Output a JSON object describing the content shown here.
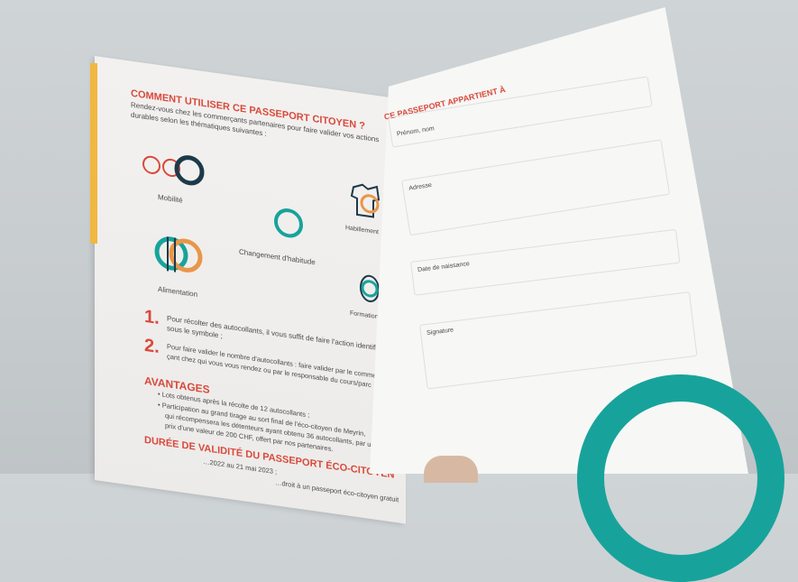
{
  "left": {
    "heading": "COMMENT UTILISER CE PASSEPORT CITOYEN ?",
    "intro1": "Rendez-vous chez les commerçants partenaires pour faire valider vos actions",
    "intro2": "durables selon les thématiques suivantes :",
    "icons": [
      "Mobilité",
      "Changement d'habitude",
      "Habillement",
      "Alimentation",
      "Formation"
    ],
    "step1_num": "1.",
    "step1_a": "Pour récolter des autocollants, il vous suffit de faire l'action identifiée",
    "step1_b": "sous le symbole ;",
    "step2_num": "2.",
    "step2_a": "Pour faire valider le nombre d'autocollants : faire valider par le commer-",
    "step2_b": "çant chez qui vous vous rendez ou par le responsable du cours/parc",
    "avantages": "AVANTAGES",
    "adv1": "• Lots obtenus après la récolte de 12 autocollants ;",
    "adv2a": "• Participation au grand tirage au sort final de l'éco-citoyen de Meyrin,",
    "adv2b": "qui récompensera les détenteurs ayant obtenu 36 autocollants, par un",
    "adv2c": "prix d'une valeur de 200 CHF, offert par nos partenaires.",
    "duree": "DURÉE DE VALIDITÉ DU PASSEPORT ÉCO-CITOYEN",
    "duree_text": "…2022 au 21 mai 2023 ;",
    "duree_text2": "…droit à un passeport éco-citoyen gratuit"
  },
  "right": {
    "heading": "CE PASSEPORT APPARTIENT À",
    "fields": [
      "Prénom, nom",
      "Adresse",
      "Date de naissance",
      "Signature"
    ]
  },
  "colors": {
    "red": "#d9493b",
    "teal": "#17a39b",
    "orange": "#e9964a",
    "navy": "#1d3a4a"
  }
}
